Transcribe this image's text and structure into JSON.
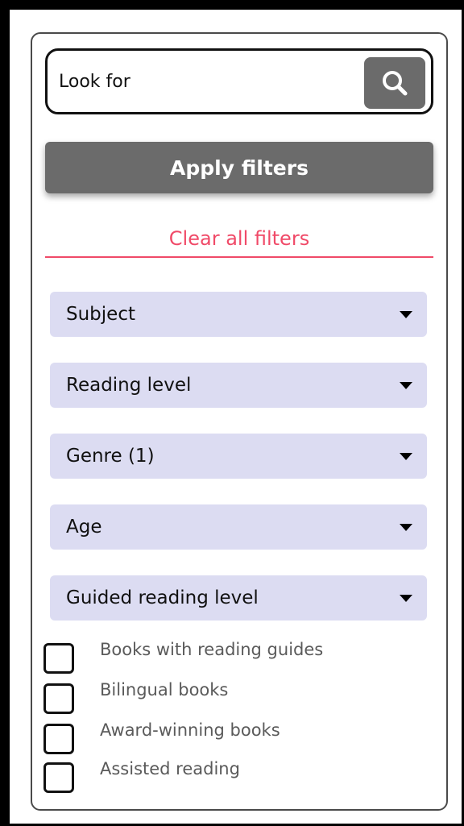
{
  "search": {
    "placeholder": "Look for",
    "icon": "search-icon"
  },
  "apply_label": "Apply filters",
  "clear_label": "Clear all filters",
  "colors": {
    "button": "#6b6b6b",
    "accent": "#f04a68",
    "dropdown": "#dcdcf2"
  },
  "dropdowns": [
    {
      "label": "Subject"
    },
    {
      "label": "Reading level"
    },
    {
      "label": "Genre (1)"
    },
    {
      "label": "Age"
    },
    {
      "label": "Guided reading level"
    }
  ],
  "checkboxes": [
    {
      "label": "Books with reading guides",
      "checked": false
    },
    {
      "label": "Bilingual books",
      "checked": false
    },
    {
      "label": "Award-winning books",
      "checked": false
    },
    {
      "label": "Assisted reading",
      "checked": false
    }
  ]
}
